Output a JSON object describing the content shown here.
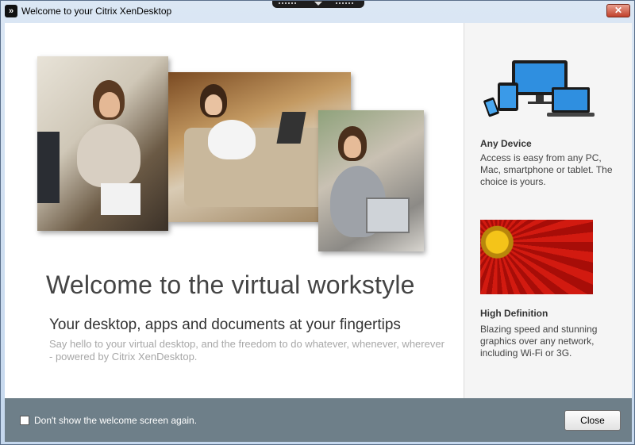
{
  "window": {
    "title": "Welcome to your Citrix XenDesktop",
    "app_icon": "citrix-receiver-icon",
    "close_glyph": "✕"
  },
  "main": {
    "headline": "Welcome to the virtual workstyle",
    "subhead": "Your desktop, apps and documents at your fingertips",
    "blurb": "Say hello to your virtual desktop, and the freedom to do whatever, whenever, wherever - powered by Citrix XenDesktop."
  },
  "features": [
    {
      "title": "Any Device",
      "text": "Access is easy from any PC, Mac, smartphone or tablet. The choice is yours.",
      "image": "devices-illustration"
    },
    {
      "title": "High Definition",
      "text": "Blazing speed and stunning graphics over any network, including Wi-Fi or 3G.",
      "image": "red-flower-photo"
    }
  ],
  "footer": {
    "checkbox_label": "Don't show the welcome screen again.",
    "checkbox_checked": false,
    "close_label": "Close"
  },
  "colors": {
    "footer_bg": "#6e7f89",
    "sidepanel_bg": "#f5f5f5",
    "headline": "#444444",
    "blurb": "#a7a7a7"
  }
}
